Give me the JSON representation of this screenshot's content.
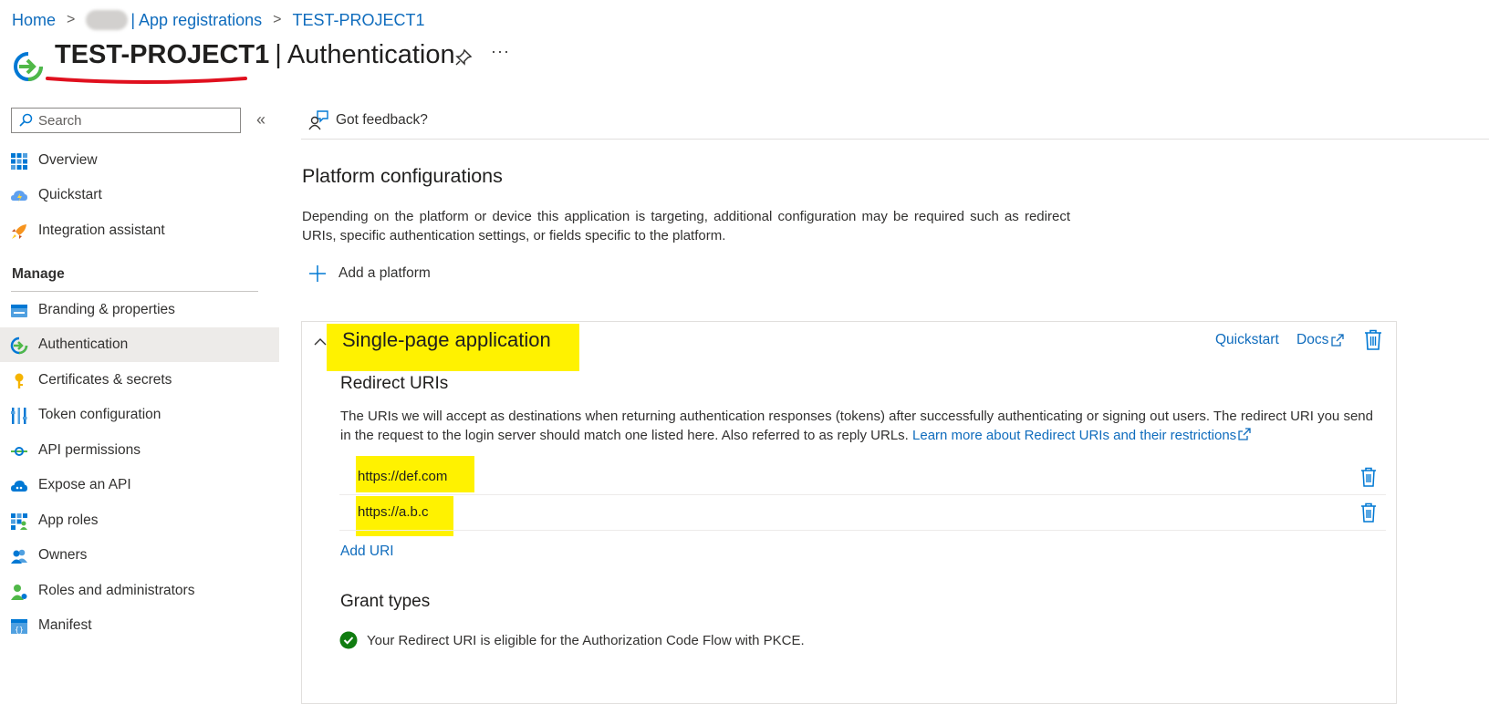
{
  "breadcrumb": {
    "home": "Home",
    "app_registrations": "| App registrations",
    "project": "TEST-PROJECT1"
  },
  "header": {
    "project_name": "TEST-PROJECT1",
    "separator": "|",
    "page_title": "Authentication",
    "more": "···"
  },
  "sidebar": {
    "search_placeholder": "Search",
    "collapse": "«",
    "items_top": [
      {
        "label": "Overview",
        "icon": "overview-grid-icon"
      },
      {
        "label": "Quickstart",
        "icon": "cloud-lightning-icon"
      },
      {
        "label": "Integration assistant",
        "icon": "rocket-icon"
      }
    ],
    "manage_heading": "Manage",
    "items_manage": [
      {
        "label": "Branding & properties",
        "icon": "branding-icon"
      },
      {
        "label": "Authentication",
        "icon": "authentication-icon",
        "active": true
      },
      {
        "label": "Certificates & secrets",
        "icon": "key-icon"
      },
      {
        "label": "Token configuration",
        "icon": "token-bars-icon"
      },
      {
        "label": "API permissions",
        "icon": "api-permissions-icon"
      },
      {
        "label": "Expose an API",
        "icon": "cloud-api-icon"
      },
      {
        "label": "App roles",
        "icon": "app-roles-icon"
      },
      {
        "label": "Owners",
        "icon": "owners-icon"
      },
      {
        "label": "Roles and administrators",
        "icon": "roles-admin-icon"
      },
      {
        "label": "Manifest",
        "icon": "manifest-icon"
      }
    ]
  },
  "content": {
    "feedback": "Got feedback?",
    "platform_heading": "Platform configurations",
    "platform_desc": "Depending on the platform or device this application is targeting, additional configuration may be required such as redirect URIs, specific authentication settings, or fields specific to the platform.",
    "add_platform": "Add a platform",
    "spa": {
      "title": "Single-page application",
      "quickstart": "Quickstart",
      "docs": "Docs",
      "redirect_heading": "Redirect URIs",
      "redirect_desc": "The URIs we will accept as destinations when returning authentication responses (tokens) after successfully authenticating or signing out users. The redirect URI you send in the request to the login server should match one listed here. Also referred to as reply URLs.",
      "learn_more": "Learn more about Redirect URIs and their restrictions",
      "uris": [
        "https://def.com",
        "https://a.b.c"
      ],
      "add_uri": "Add URI",
      "grant_heading": "Grant types",
      "grant_status": "Your Redirect URI is eligible for the Authorization Code Flow with PKCE."
    }
  },
  "colors": {
    "accent": "#0f6cbd",
    "highlight": "#fff200",
    "annotation_red": "#e0101e",
    "success": "#107c10",
    "active_nav_bg": "#edebe9"
  }
}
